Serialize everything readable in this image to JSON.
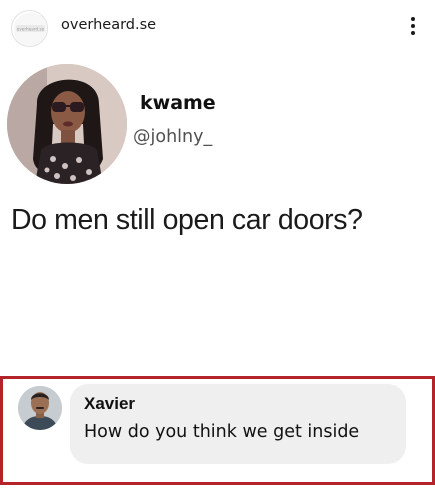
{
  "header": {
    "account_name": "overheard.se",
    "avatar_text": "overheard.se",
    "more_icon": "vertical-ellipsis-icon"
  },
  "tweet": {
    "display_name": "kwame",
    "handle": "@johlny_",
    "text": "Do men still open car doors?"
  },
  "comment": {
    "author": "Xavier",
    "text": "How do you think we get inside",
    "highlight_color": "#b5232a"
  }
}
